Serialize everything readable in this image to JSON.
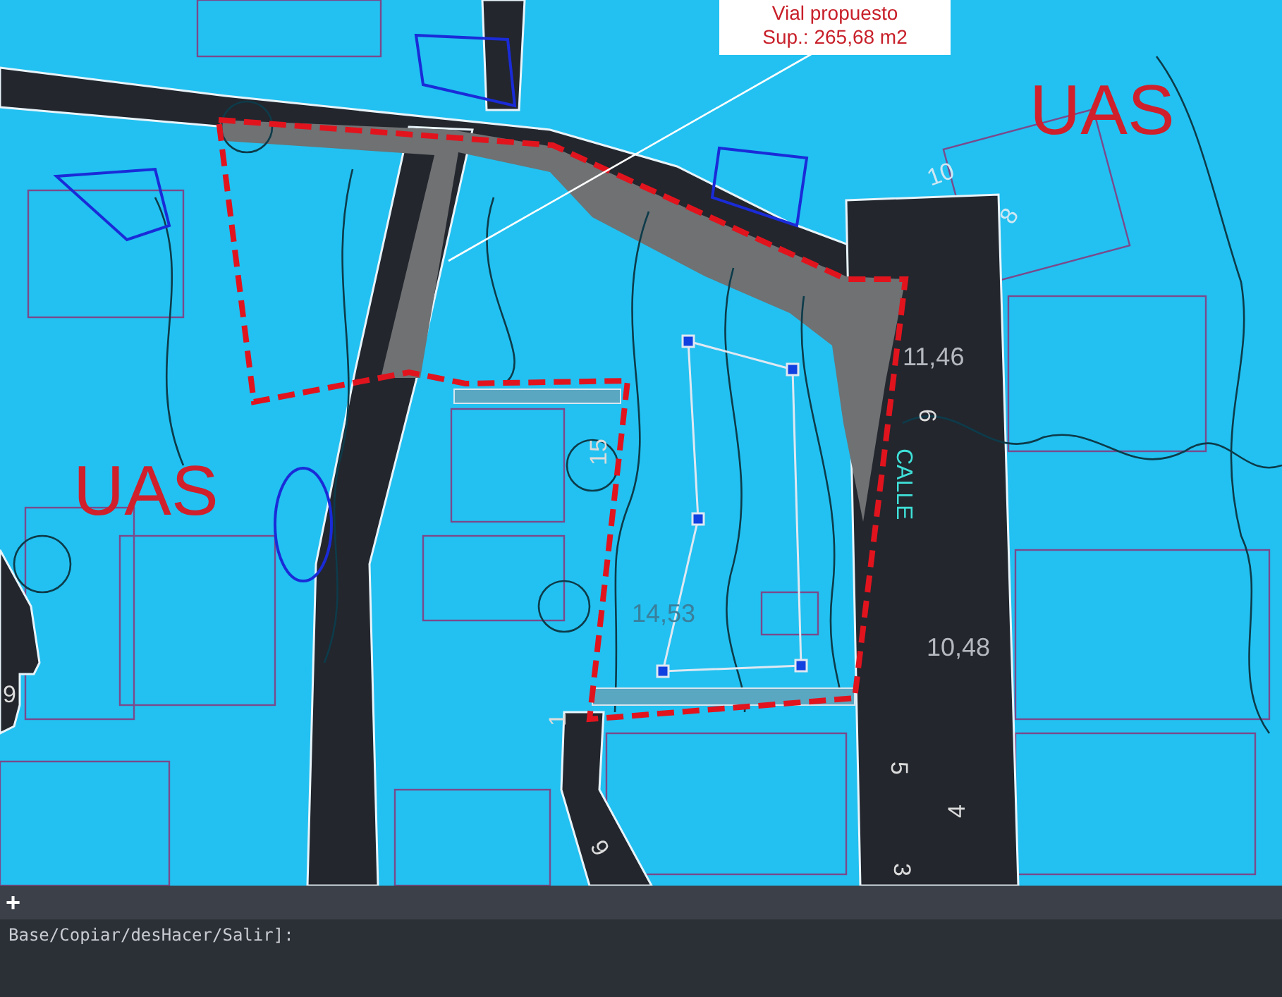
{
  "map": {
    "zone_labels": [
      "UAS",
      "UAS"
    ],
    "tooltip": {
      "title": "Vial propuesto",
      "area": "Sup.: 265,68 m2"
    },
    "elevations": [
      "11,46",
      "10,48",
      "14,53"
    ],
    "street_label": "CALLE",
    "contour_numbers": [
      "10",
      "8",
      "6",
      "15",
      "1",
      "5",
      "4",
      "9",
      "3",
      "9"
    ]
  },
  "tab_bar": {
    "add_label": "+"
  },
  "command_line": {
    "prompt": "Base/Copiar/desHacer/Salir]:"
  }
}
